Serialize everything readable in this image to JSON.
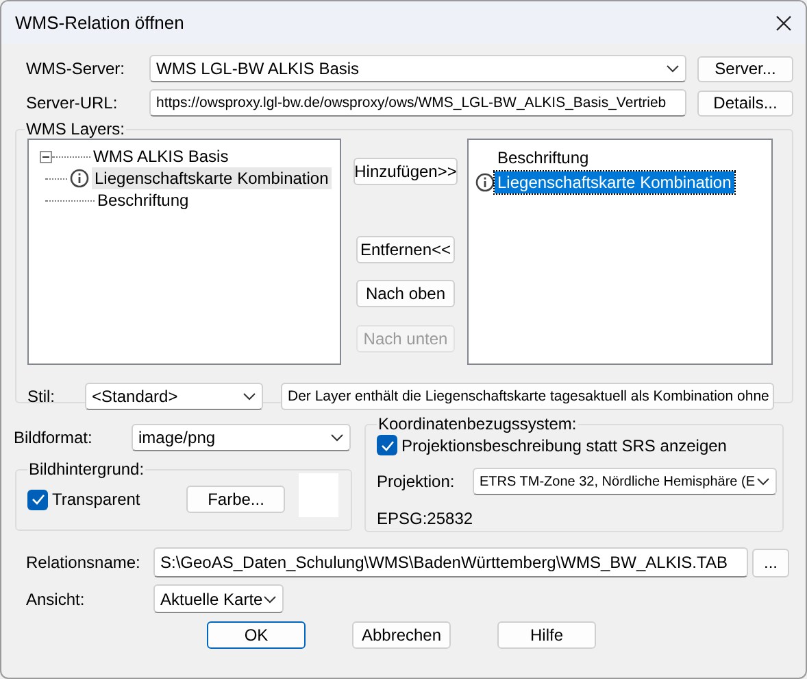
{
  "window": {
    "title": "WMS-Relation öffnen"
  },
  "server": {
    "label": "WMS-Server:",
    "value": "WMS LGL-BW ALKIS Basis",
    "button": "Server..."
  },
  "server_url": {
    "label": "Server-URL:",
    "value": "https://owsproxy.lgl-bw.de/owsproxy/ows/WMS_LGL-BW_ALKIS_Basis_Vertrieb",
    "button": "Details..."
  },
  "layers": {
    "label": "WMS Layers:",
    "tree": [
      {
        "label": "WMS ALKIS Basis",
        "expanded": true,
        "info": false,
        "selected": false,
        "children": [
          {
            "label": "Liegenschaftskarte Kombination",
            "info": true,
            "selected": true
          },
          {
            "label": "Beschriftung",
            "info": false,
            "selected": false
          }
        ]
      }
    ],
    "buttons": [
      {
        "label": "Hinzufügen>>",
        "disabled": false
      },
      {
        "label": "Entfernen<<",
        "disabled": false
      },
      {
        "label": "Nach oben",
        "disabled": false
      },
      {
        "label": "Nach unten",
        "disabled": true
      }
    ],
    "selected_layers": [
      {
        "label": "Beschriftung",
        "info": false,
        "selected": false
      },
      {
        "label": "Liegenschaftskarte Kombination",
        "info": true,
        "selected": true
      }
    ],
    "style": {
      "label": "Stil:",
      "value": "<Standard>"
    },
    "description": "Der Layer enthält die Liegenschaftskarte tagesaktuell als Kombination ohne"
  },
  "image": {
    "format_label": "Bildformat:",
    "format": "image/png",
    "background_label": "Bildhintergrund:",
    "transparent": {
      "label": "Transparent",
      "checked": true
    },
    "color_button": "Farbe..."
  },
  "crs": {
    "label": "Koordinatenbezugssystem:",
    "show_description": {
      "label": "Projektionsbeschreibung statt SRS anzeigen",
      "checked": true
    },
    "projection_label": "Projektion:",
    "projection": "ETRS TM-Zone 32, Nördliche Hemisphäre (E",
    "code": "EPSG:25832"
  },
  "relation": {
    "label": "Relationsname:",
    "value": "S:\\GeoAS_Daten_Schulung\\WMS\\BadenWürttemberg\\WMS_BW_ALKIS.TAB",
    "browse": "..."
  },
  "view": {
    "label": "Ansicht:",
    "value": "Aktuelle Karte"
  },
  "buttons": [
    {
      "label": "OK",
      "default": true
    },
    {
      "label": "Abbrechen",
      "default": false
    },
    {
      "label": "Hilfe",
      "default": false
    }
  ]
}
